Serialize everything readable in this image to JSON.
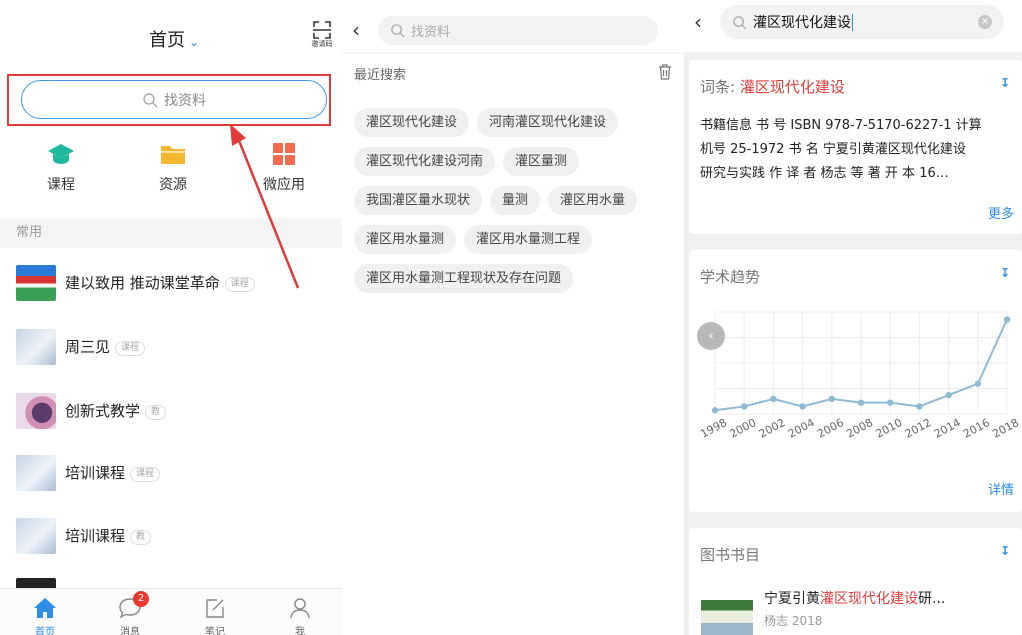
{
  "panel1": {
    "title": "首页",
    "scan_caption": "邀请码",
    "search_placeholder": "找资料",
    "quick_actions": [
      {
        "label": "课程",
        "icon": "graduation-cap-icon",
        "color": "#1fb89a"
      },
      {
        "label": "资源",
        "icon": "folder-icon",
        "color": "#f5b72e"
      },
      {
        "label": "微应用",
        "icon": "grid-apps-icon",
        "color": "#f36c4f"
      }
    ],
    "section_label": "常用",
    "courses": [
      {
        "name": "建以致用 推动课堂革命",
        "tag": "课程"
      },
      {
        "name": "周三见",
        "tag": "课程"
      },
      {
        "name": "创新式教学",
        "tag": "教"
      },
      {
        "name": "培训课程",
        "tag": "课程"
      },
      {
        "name": "培训课程",
        "tag": "教"
      }
    ],
    "tabs": [
      {
        "label": "首页",
        "icon": "home-icon"
      },
      {
        "label": "消息",
        "icon": "chat-bubble-icon",
        "badge": "2"
      },
      {
        "label": "笔记",
        "icon": "note-edit-icon"
      },
      {
        "label": "我",
        "icon": "person-icon"
      }
    ]
  },
  "panel2": {
    "search_placeholder": "找资料",
    "recent_label": "最近搜索",
    "history": [
      "灌区现代化建设",
      "河南灌区现代化建设",
      "灌区现代化建设河南",
      "灌区量测",
      "我国灌区量水现状",
      "量测",
      "灌区用水量",
      "灌区用水量测",
      "灌区用水量测工程",
      "灌区用水量测工程现状及存在问题"
    ]
  },
  "panel3": {
    "search_value": "灌区现代化建设",
    "term_card": {
      "prefix": "词条: ",
      "term": "灌区现代化建设",
      "lines": [
        "书籍信息     书  号 ISBN 978-7-5170-6227-1 计算",
        "机号 25-1972     书  名 宁夏引黄灌区现代化建设",
        "研究与实践     作 译 者 杨志 等 著      开  本 16…"
      ],
      "more_label": "更多"
    },
    "trend_card": {
      "title": "学术趋势",
      "detail_label": "详情"
    },
    "book_card": {
      "title": "图书书目",
      "book_prefix": "宁夏引黄",
      "book_highlight": "灌区现代化建设",
      "book_suffix": "研...",
      "book_meta": "杨志  2018"
    },
    "colors": {
      "accent": "#2b8de6",
      "highlight": "#e03c3c",
      "line": "#8fbad3"
    }
  },
  "chart_data": {
    "type": "line",
    "title": "",
    "x": [
      "1998",
      "2000",
      "2002",
      "2004",
      "2006",
      "2008",
      "2010",
      "2012",
      "2014",
      "2016",
      "2018"
    ],
    "series": [
      {
        "values": [
          1,
          2,
          4,
          2,
          4,
          3,
          3,
          2,
          5,
          8,
          25
        ]
      }
    ],
    "ylim": [
      0,
      27
    ],
    "grid": true
  }
}
